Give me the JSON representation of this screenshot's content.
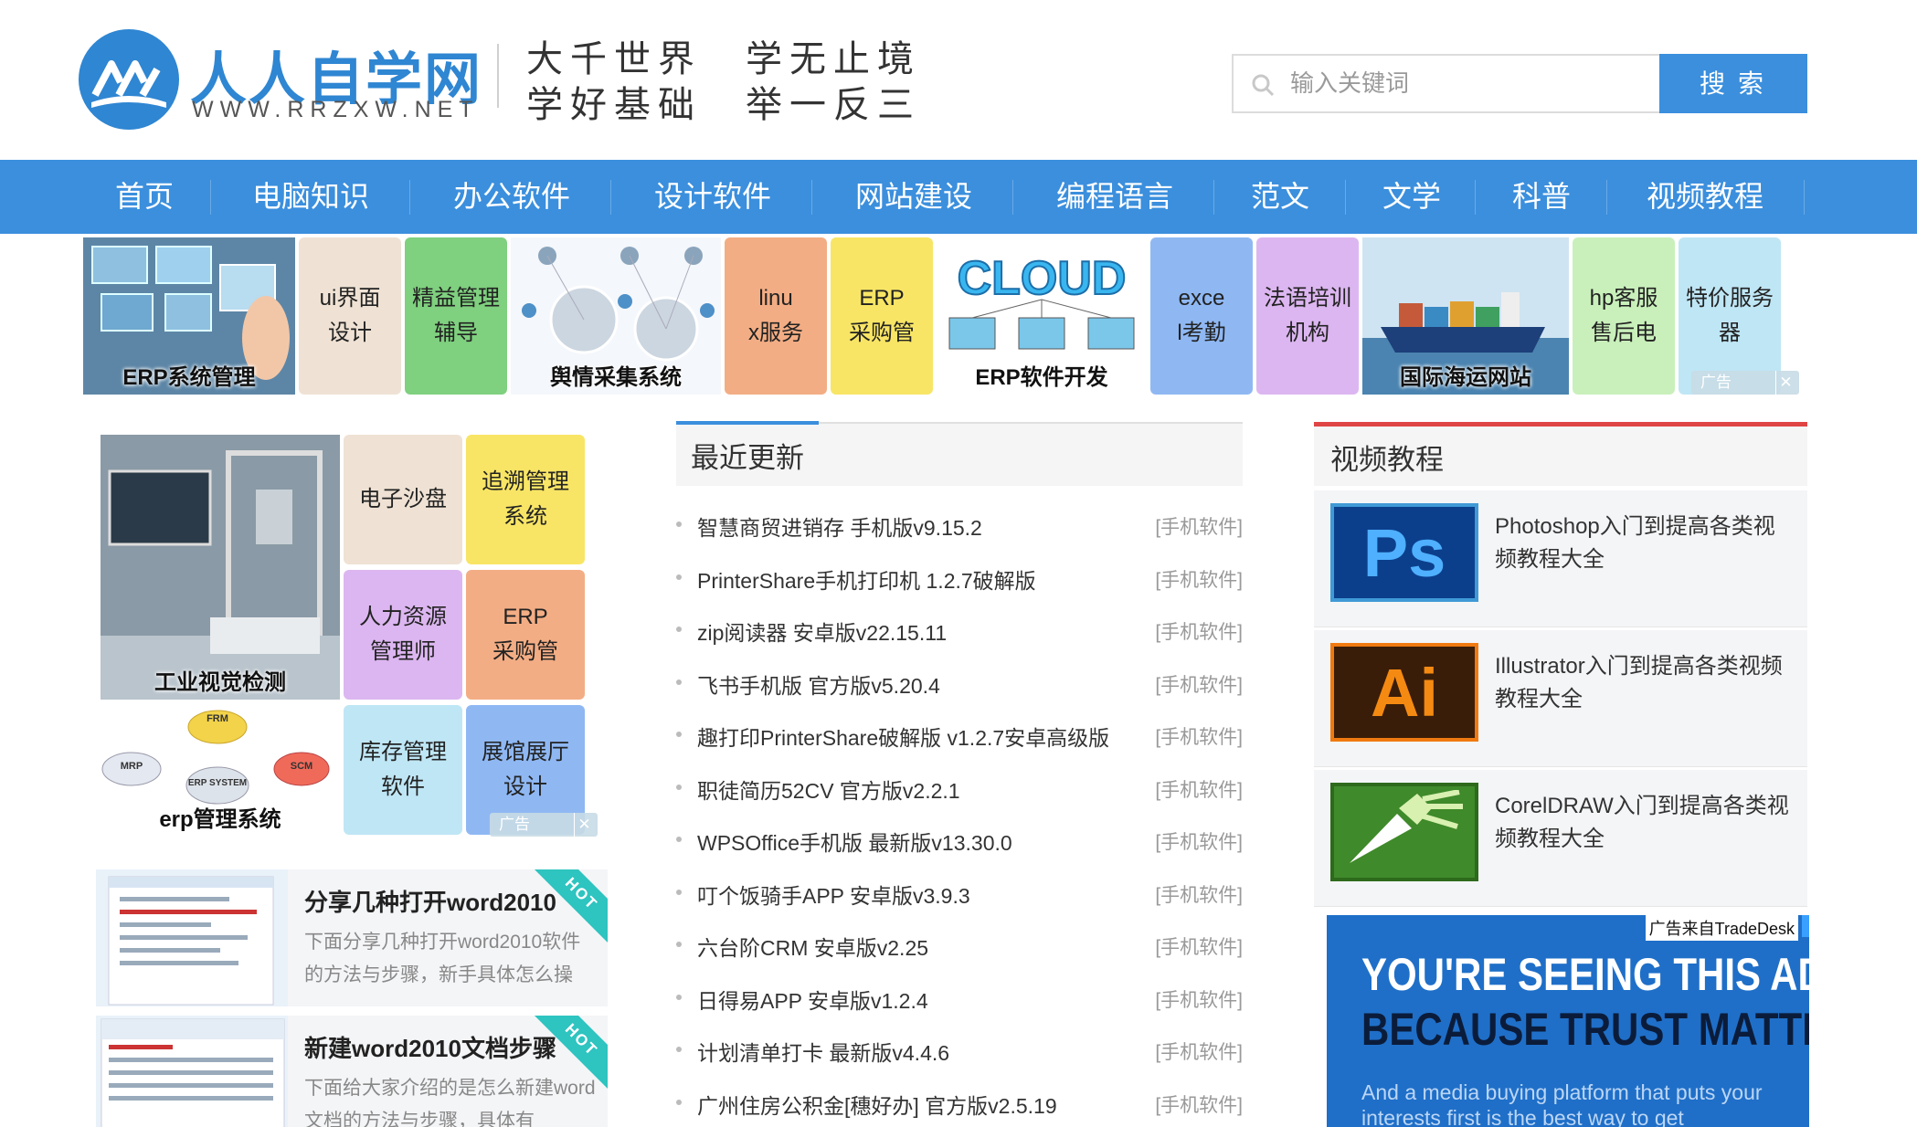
{
  "header": {
    "logo_cn": "人人自学网",
    "logo_en": "WWW.RRZXW.NET",
    "slogan_line1": "大千世界　学无止境",
    "slogan_line2": "学好基础　举一反三"
  },
  "search": {
    "placeholder": "输入关键词",
    "button": "搜索"
  },
  "nav": {
    "items": [
      "首页",
      "电脑知识",
      "办公软件",
      "设计软件",
      "网站建设",
      "编程语言",
      "范文",
      "文学",
      "科普",
      "视频教程"
    ]
  },
  "top_ads": {
    "tiles": [
      "ERP系统管理",
      "ui界面设计",
      "精益管理辅导",
      "舆情采集系统",
      "linux服务",
      "ERP采购管",
      "CLOUD",
      "ERP软件开发",
      "excel考勤",
      "法语培训机构",
      "国际海运网站",
      "hp客服售后电",
      "特价服务器"
    ],
    "tile_lines": {
      "ui": [
        "ui界面",
        "设计"
      ],
      "lean": [
        "精益管理",
        "辅导"
      ],
      "linux": [
        "linu",
        "x服务"
      ],
      "erp_buy": [
        "ERP",
        "采购管"
      ],
      "excel": [
        "exce",
        "l考勤"
      ],
      "french": [
        "法语培训",
        "机构"
      ],
      "hp": [
        "hp客服",
        "售后电"
      ],
      "server": [
        "特价服务",
        "器"
      ]
    },
    "ad_label": "广告"
  },
  "left_ads": {
    "machine_caption": "工业视觉检测",
    "erp_caption": "erp管理系统",
    "erp_nodes": [
      "FRM",
      "MRP",
      "SCM",
      "ERP SYSTEM"
    ],
    "tiles": [
      [
        "电子沙盘"
      ],
      [
        "追溯管理",
        "系统"
      ],
      [
        "人力资源",
        "管理师"
      ],
      [
        "ERP",
        "采购管"
      ],
      [
        "库存管理",
        "软件"
      ],
      [
        "展馆展厅",
        "设计"
      ]
    ],
    "ad_label": "广告"
  },
  "recommended": [
    {
      "title": "分享几种打开word2010",
      "desc": "下面分享几种打开word2010软件的方法与步骤，新手具体怎么操",
      "badge": "HOT"
    },
    {
      "title": "新建word2010文档步骤",
      "desc": "下面给大家介绍的是怎么新建word文档的方法与步骤，具体有",
      "badge": "HOT"
    }
  ],
  "recent": {
    "title": "最近更新",
    "items": [
      {
        "title": "智慧商贸进销存 手机版v9.15.2",
        "category": "[手机软件]"
      },
      {
        "title": "PrinterShare手机打印机 1.2.7破解版",
        "category": "[手机软件]"
      },
      {
        "title": "zip阅读器 安卓版v22.15.11",
        "category": "[手机软件]"
      },
      {
        "title": "飞书手机版 官方版v5.20.4",
        "category": "[手机软件]"
      },
      {
        "title": "趣打印PrinterShare破解版 v1.2.7安卓高级版",
        "category": "[手机软件]"
      },
      {
        "title": "职徒简历52CV 官方版v2.2.1",
        "category": "[手机软件]"
      },
      {
        "title": "WPSOffice手机版 最新版v13.30.0",
        "category": "[手机软件]"
      },
      {
        "title": "叮个饭骑手APP 安卓版v3.9.3",
        "category": "[手机软件]"
      },
      {
        "title": "六台阶CRM 安卓版v2.25",
        "category": "[手机软件]"
      },
      {
        "title": "日得易APP 安卓版v1.2.4",
        "category": "[手机软件]"
      },
      {
        "title": "计划清单打卡 最新版v4.4.6",
        "category": "[手机软件]"
      },
      {
        "title": "广州住房公积金[穗好办] 官方版v2.5.19",
        "category": "[手机软件]"
      }
    ]
  },
  "video": {
    "title": "视频教程",
    "items": [
      {
        "icon": "Ps",
        "title": "Photoshop入门到提高各类视频教程大全"
      },
      {
        "icon": "Ai",
        "title": "Illustrator入门到提高各类视频教程大全"
      },
      {
        "icon": "CorelDRAW",
        "title": "CorelDRAW入门到提高各类视频教程大全"
      }
    ]
  },
  "tradedesk": {
    "label": "广告来自TradeDesk",
    "headline1": "YOU'RE SEEING THIS AD",
    "headline2": "BECAUSE TRUST MATTERS",
    "body": "And a media buying platform that puts your interests first is the best way to get"
  },
  "colors": {
    "brand_blue": "#3b8fdd",
    "accent_red": "#e04545",
    "hot_teal": "#2ec4c0"
  }
}
